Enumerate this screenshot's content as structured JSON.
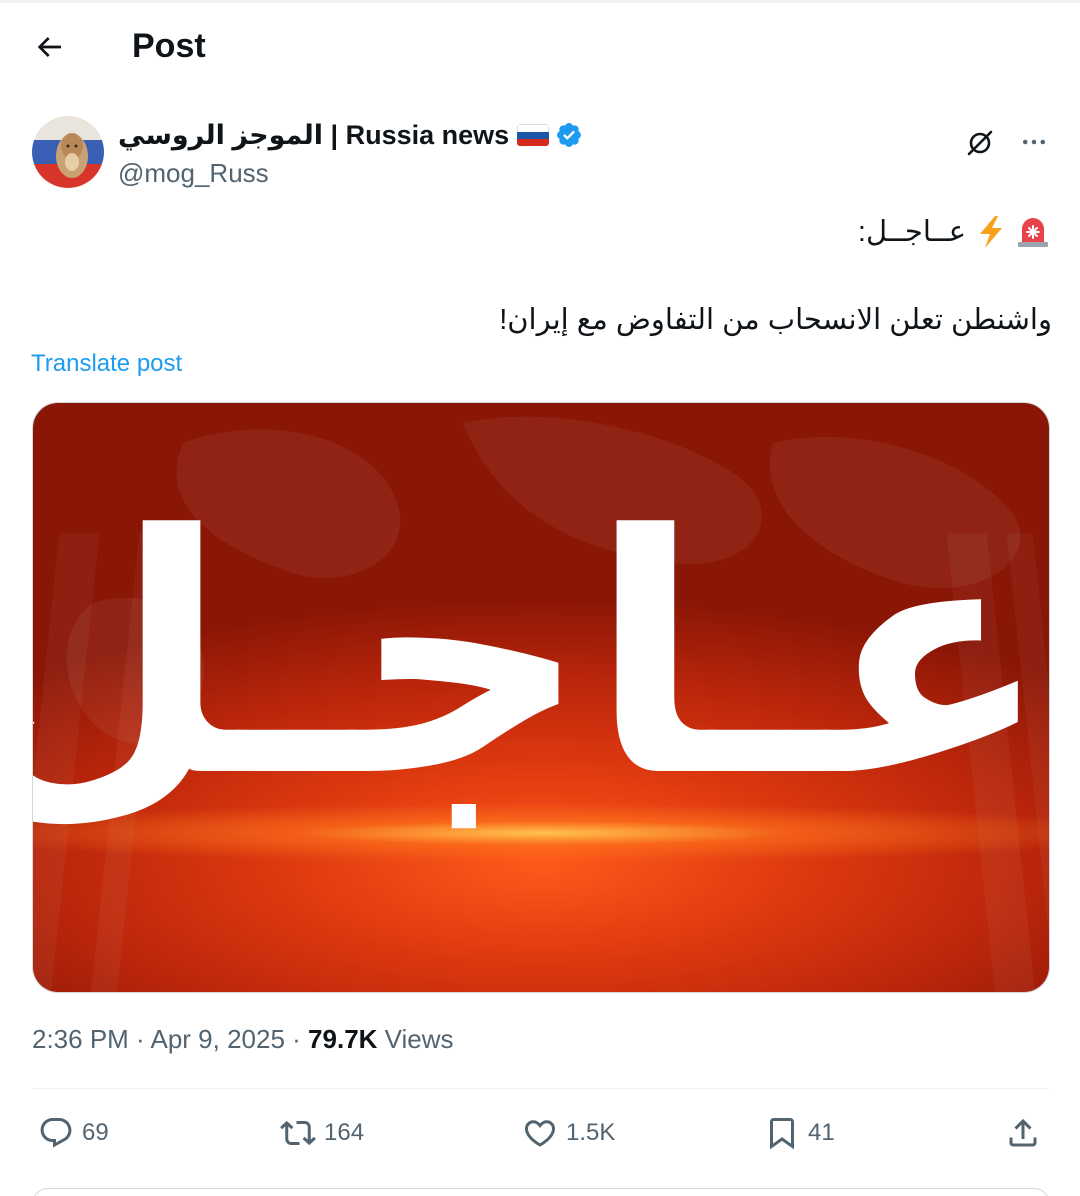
{
  "header": {
    "title": "Post"
  },
  "author": {
    "display_name": "الموجز الروسي | Russia news",
    "handle": "@mog_Russ",
    "verified": true,
    "flag_colors": [
      "#ffffff",
      "#1c57a7",
      "#d52b1e"
    ]
  },
  "tweet": {
    "line1": "عــاجــل:",
    "line2": "واشنطن تعلن الانسحاب من التفاوض مع إيران!",
    "translate_label": "Translate post",
    "emojis": [
      "rotating-light-icon",
      "lightning-icon"
    ]
  },
  "media": {
    "image_text": "عـاجـل"
  },
  "meta": {
    "time": "2:36 PM",
    "separator": " · ",
    "date": "Apr 9, 2025",
    "separator2": " · ",
    "views_count": "79.7K",
    "views_label": " Views"
  },
  "actions": {
    "replies": "69",
    "reposts": "164",
    "likes": "1.5K",
    "bookmarks": "41"
  },
  "colors": {
    "accent": "#1d9bf0",
    "text_primary": "#0f1419",
    "text_secondary": "#536471",
    "media_red": "#c62d0c"
  }
}
